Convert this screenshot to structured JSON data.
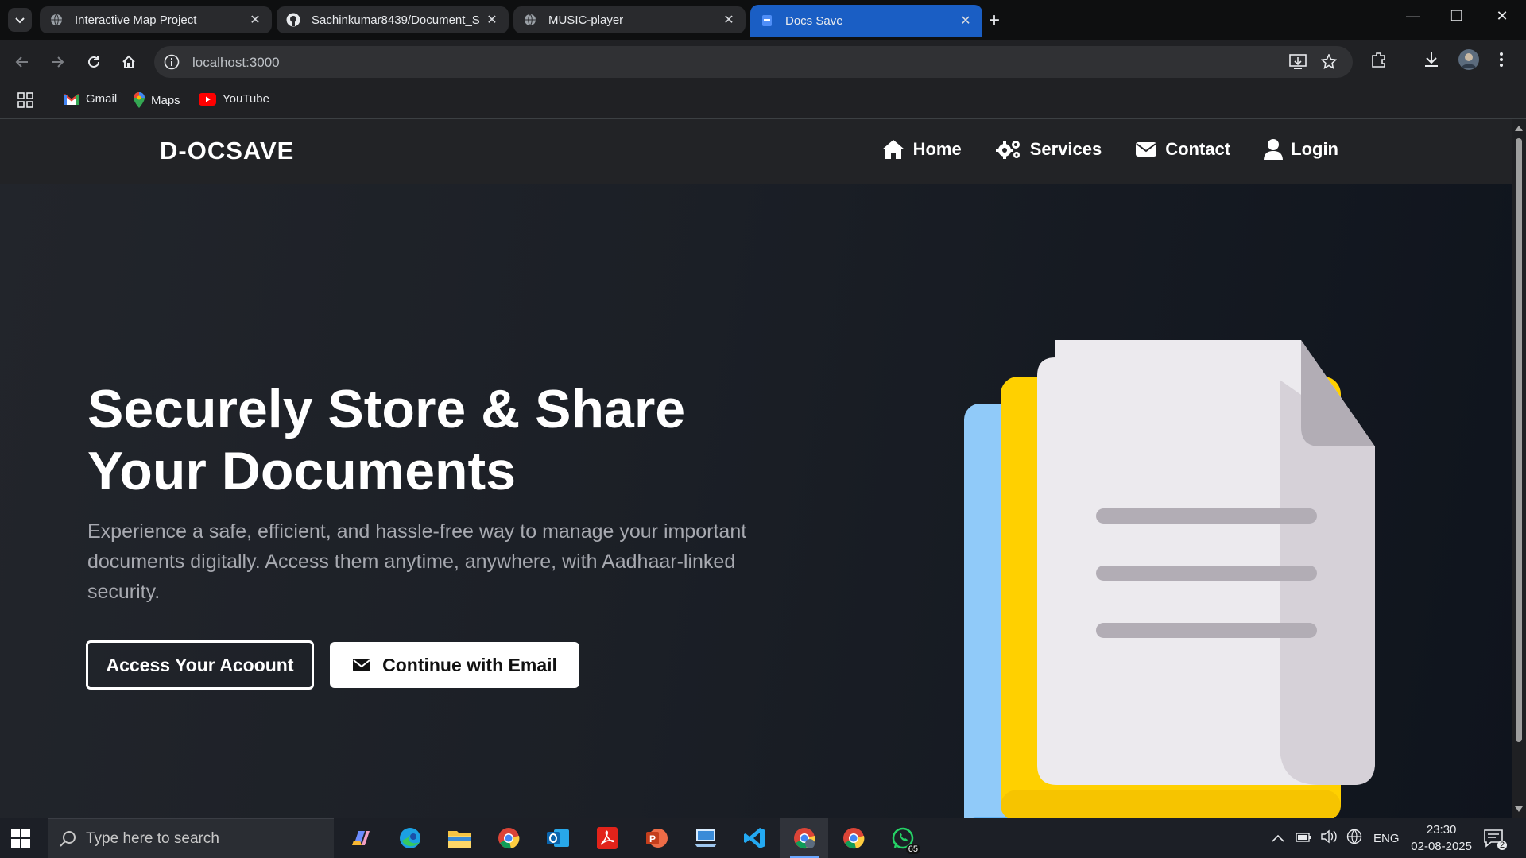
{
  "browser": {
    "tabs": [
      {
        "title": "Interactive Map Project",
        "active": false
      },
      {
        "title": "Sachinkumar8439/Document_S",
        "active": false
      },
      {
        "title": "MUSIC-player",
        "active": false
      },
      {
        "title": "Docs Save",
        "active": true
      }
    ],
    "url": "localhost:3000",
    "bookmarks": [
      {
        "label": "Gmail"
      },
      {
        "label": "Maps"
      },
      {
        "label": "YouTube"
      }
    ]
  },
  "site": {
    "logo": "D-OCSAVE",
    "nav": {
      "home": "Home",
      "services": "Services",
      "contact": "Contact",
      "login": "Login"
    },
    "hero": {
      "title": "Securely Store & Share Your Documents",
      "description": "Experience a safe, efficient, and hassle-free way to manage your important documents digitally. Access them anytime, anywhere, with Aadhaar-linked security.",
      "primary_button": "Access Your Acoount",
      "email_button": "Continue with Email"
    },
    "colors": {
      "doc_back": "#90caf9",
      "doc_middle": "#ffd000",
      "doc_front": "#eceaee",
      "accent_tab": "#1a5ec4"
    }
  },
  "taskbar": {
    "search_placeholder": "Type here to search",
    "language": "ENG",
    "time": "23:30",
    "date": "02-08-2025",
    "whatsapp_badge": "65",
    "notification_count": "2"
  }
}
